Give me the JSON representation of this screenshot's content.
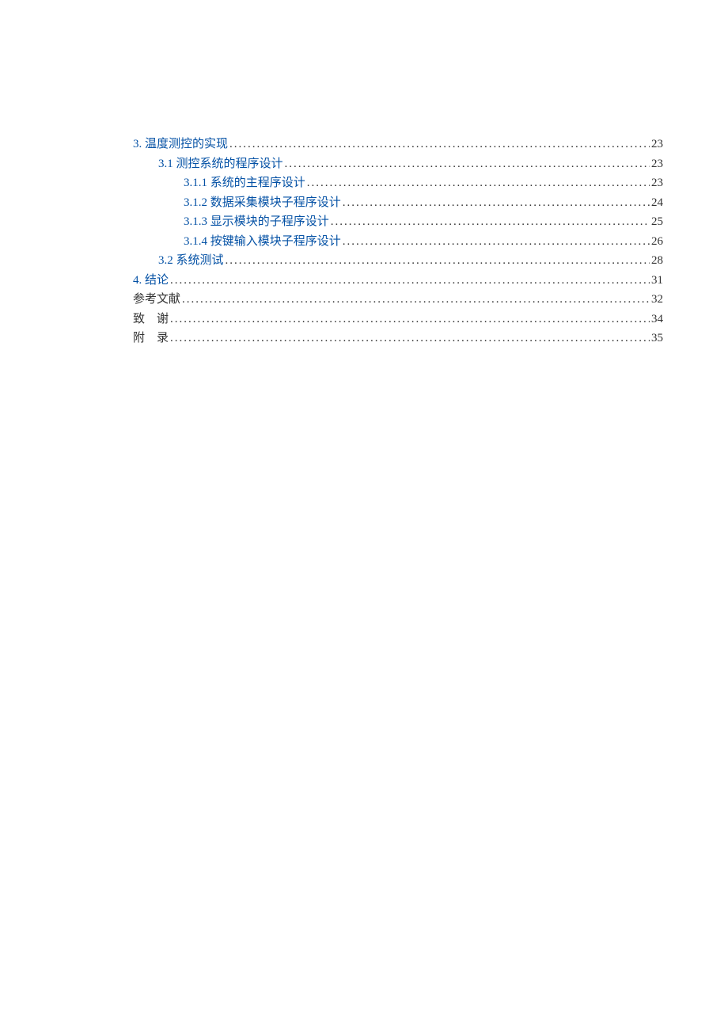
{
  "toc": [
    {
      "title": "3. 温度测控的实现",
      "page": "23",
      "indent": 0,
      "link": true
    },
    {
      "title": "3.1 测控系统的程序设计",
      "page": "23",
      "indent": 1,
      "link": true
    },
    {
      "title": "3.1.1 系统的主程序设计",
      "page": "23",
      "indent": 2,
      "link": true
    },
    {
      "title": "3.1.2 数据采集模块子程序设计",
      "page": "24",
      "indent": 2,
      "link": true
    },
    {
      "title": "3.1.3 显示模块的子程序设计",
      "page": "25",
      "indent": 2,
      "link": true
    },
    {
      "title": "3.1.4 按键输入模块子程序设计",
      "page": "26",
      "indent": 2,
      "link": true
    },
    {
      "title": "3.2 系统测试",
      "page": "28",
      "indent": 1,
      "link": true
    },
    {
      "title": "4. 结论",
      "page": "31",
      "indent": 0,
      "link": true
    },
    {
      "title": "参考文献",
      "page": "32",
      "indent": 0,
      "link": false
    },
    {
      "title": "致　谢",
      "page": "34",
      "indent": 0,
      "link": false
    },
    {
      "title": "附　录",
      "page": "35",
      "indent": 0,
      "link": false
    }
  ],
  "dots": "...................................................................................................................................................................."
}
